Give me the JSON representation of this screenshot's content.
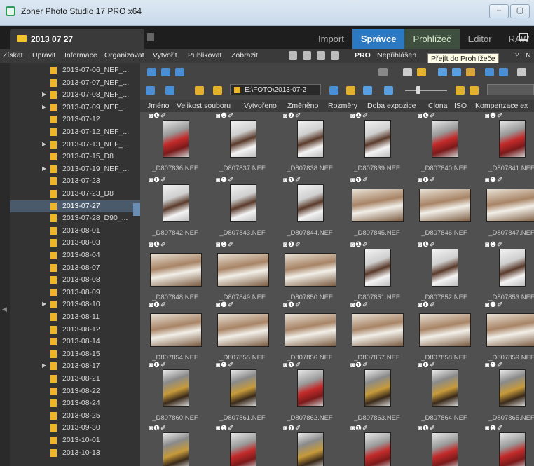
{
  "window": {
    "title": "Zoner Photo Studio 17 PRO x64",
    "controls": [
      "–",
      "▢"
    ]
  },
  "tabs": {
    "document_tab": "2013 07 27",
    "modes": [
      "Import",
      "Správce",
      "Prohlížeč",
      "Editor",
      "RAW"
    ],
    "active_mode": "Správce"
  },
  "menu": {
    "items": [
      "Získat",
      "Upravit",
      "Informace",
      "Organizovat",
      "Vytvořit",
      "Publikovat",
      "Zobrazit"
    ],
    "pro": "PRO",
    "login": "Nepřihlášen",
    "help": "?",
    "extra": "N"
  },
  "tooltip": "Přejít do Prohlížeče",
  "folders": [
    {
      "label": "2013-07-06_NEF_...",
      "expand": false
    },
    {
      "label": "2013-07-07_NEF_...",
      "expand": false
    },
    {
      "label": "2013-07-08_NEF_...",
      "expand": true
    },
    {
      "label": "2013-07-09_NEF_...",
      "expand": true
    },
    {
      "label": "2013-07-12",
      "expand": false
    },
    {
      "label": "2013-07-12_NEF_...",
      "expand": false
    },
    {
      "label": "2013-07-13_NEF_...",
      "expand": true
    },
    {
      "label": "2013-07-15_D8",
      "expand": false
    },
    {
      "label": "2013-07-19_NEF_...",
      "expand": true
    },
    {
      "label": "2013-07-23",
      "expand": false
    },
    {
      "label": "2013-07-23_D8",
      "expand": false
    },
    {
      "label": "2013-07-27",
      "expand": false,
      "selected": true
    },
    {
      "label": "2013-07-28_D90_...",
      "expand": false
    },
    {
      "label": "2013-08-01",
      "expand": false
    },
    {
      "label": "2013-08-03",
      "expand": false
    },
    {
      "label": "2013-08-04",
      "expand": false
    },
    {
      "label": "2013-08-07",
      "expand": false
    },
    {
      "label": "2013-08-08",
      "expand": false
    },
    {
      "label": "2013-08-09",
      "expand": false
    },
    {
      "label": "2013-08-10",
      "expand": true
    },
    {
      "label": "2013-08-11",
      "expand": false
    },
    {
      "label": "2013-08-12",
      "expand": false
    },
    {
      "label": "2013-08-14",
      "expand": false
    },
    {
      "label": "2013-08-15",
      "expand": false
    },
    {
      "label": "2013-08-17",
      "expand": true
    },
    {
      "label": "2013-08-21",
      "expand": false
    },
    {
      "label": "2013-08-22",
      "expand": false
    },
    {
      "label": "2013-08-24",
      "expand": false
    },
    {
      "label": "2013-08-25",
      "expand": false
    },
    {
      "label": "2013-09-30",
      "expand": false
    },
    {
      "label": "2013-10-01",
      "expand": false
    },
    {
      "label": "2013-10-13",
      "expand": false
    }
  ],
  "path": "E:\\FOTO\\2013-07-2",
  "columns": [
    "Jméno",
    "Velikost souboru",
    "Vytvořeno",
    "Změněno",
    "Rozměry",
    "Doba expozice",
    "Clona",
    "ISO",
    "Kompenzace ex"
  ],
  "thumb_icons": "◙❶✐",
  "photos": [
    {
      "name": "_D807836.NEF",
      "orient": "portrait",
      "tone": "red"
    },
    {
      "name": "_D807837.NEF",
      "orient": "portrait",
      "tone": "default"
    },
    {
      "name": "_D807838.NEF",
      "orient": "portrait",
      "tone": "default"
    },
    {
      "name": "_D807839.NEF",
      "orient": "portrait",
      "tone": "default"
    },
    {
      "name": "_D807840.NEF",
      "orient": "portrait",
      "tone": "red"
    },
    {
      "name": "_D807841.NEF",
      "orient": "portrait",
      "tone": "red"
    },
    {
      "name": "_D807842.NEF",
      "orient": "portrait",
      "tone": "default"
    },
    {
      "name": "_D807843.NEF",
      "orient": "portrait",
      "tone": "default"
    },
    {
      "name": "_D807844.NEF",
      "orient": "portrait",
      "tone": "default"
    },
    {
      "name": "_D807845.NEF",
      "orient": "landscape",
      "tone": "landscape"
    },
    {
      "name": "_D807846.NEF",
      "orient": "landscape",
      "tone": "landscape"
    },
    {
      "name": "_D807847.NEF",
      "orient": "landscape",
      "tone": "landscape"
    },
    {
      "name": "_D807848.NEF",
      "orient": "landscape",
      "tone": "landscape"
    },
    {
      "name": "_D807849.NEF",
      "orient": "landscape",
      "tone": "landscape"
    },
    {
      "name": "_D807850.NEF",
      "orient": "landscape",
      "tone": "landscape"
    },
    {
      "name": "_D807851.NEF",
      "orient": "portrait",
      "tone": "default"
    },
    {
      "name": "_D807852.NEF",
      "orient": "portrait",
      "tone": "default"
    },
    {
      "name": "_D807853.NEF",
      "orient": "portrait",
      "tone": "default"
    },
    {
      "name": "_D807854.NEF",
      "orient": "landscape",
      "tone": "landscape"
    },
    {
      "name": "_D807855.NEF",
      "orient": "landscape",
      "tone": "landscape"
    },
    {
      "name": "_D807856.NEF",
      "orient": "landscape",
      "tone": "landscape"
    },
    {
      "name": "_D807857.NEF",
      "orient": "landscape",
      "tone": "landscape"
    },
    {
      "name": "_D807858.NEF",
      "orient": "landscape",
      "tone": "landscape"
    },
    {
      "name": "_D807859.NEF",
      "orient": "landscape",
      "tone": "landscape"
    },
    {
      "name": "_D807860.NEF",
      "orient": "portrait",
      "tone": "guitar"
    },
    {
      "name": "_D807861.NEF",
      "orient": "portrait",
      "tone": "guitar"
    },
    {
      "name": "_D807862.NEF",
      "orient": "portrait",
      "tone": "red"
    },
    {
      "name": "_D807863.NEF",
      "orient": "portrait",
      "tone": "guitar"
    },
    {
      "name": "_D807864.NEF",
      "orient": "portrait",
      "tone": "guitar"
    },
    {
      "name": "_D807865.NEF",
      "orient": "portrait",
      "tone": "guitar"
    },
    {
      "name": "",
      "orient": "portrait",
      "tone": "guitar"
    },
    {
      "name": "",
      "orient": "portrait",
      "tone": "red"
    },
    {
      "name": "",
      "orient": "portrait",
      "tone": "guitar"
    },
    {
      "name": "",
      "orient": "portrait",
      "tone": "red"
    },
    {
      "name": "",
      "orient": "portrait",
      "tone": "red"
    },
    {
      "name": "",
      "orient": "portrait",
      "tone": "red"
    }
  ],
  "colors": {
    "accent": "#2b79c2",
    "selection": "#4b5a6a",
    "folder": "#f0b427"
  }
}
